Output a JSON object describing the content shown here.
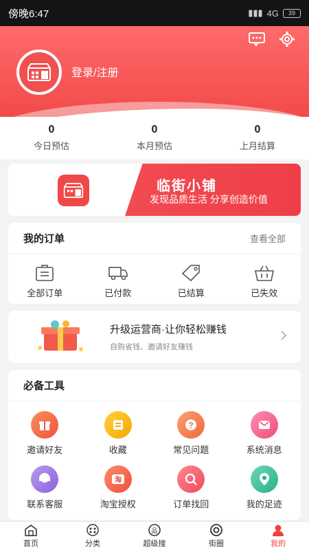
{
  "status": {
    "time": "傍晚6:47",
    "network": "4G",
    "battery": "39"
  },
  "header": {
    "login": "登录/注册"
  },
  "stats": [
    {
      "value": "0",
      "label": "今日预估"
    },
    {
      "value": "0",
      "label": "本月预估"
    },
    {
      "value": "0",
      "label": "上月结算"
    }
  ],
  "banner": {
    "title": "临街小铺",
    "subtitle": "发现品质生活 分享创造价值"
  },
  "orders": {
    "title": "我的订单",
    "more": "查看全部",
    "items": [
      {
        "label": "全部订单",
        "icon": "list-icon"
      },
      {
        "label": "已付款",
        "icon": "truck-icon"
      },
      {
        "label": "已结算",
        "icon": "tag-icon"
      },
      {
        "label": "已失效",
        "icon": "basket-icon"
      }
    ]
  },
  "upgrade": {
    "title": "升级运营商·让你轻松赚钱",
    "subtitle": "自购省钱、邀请好友赚钱"
  },
  "tools": {
    "title": "必备工具",
    "items": [
      {
        "label": "邀请好友",
        "color": "#f26a4b",
        "icon": "gift-icon"
      },
      {
        "label": "收藏",
        "color": "#f5b400",
        "icon": "bookmark-icon"
      },
      {
        "label": "常见问题",
        "color": "#f47a4f",
        "icon": "question-icon"
      },
      {
        "label": "系统消息",
        "color": "#f45a86",
        "icon": "mail-icon"
      },
      {
        "label": "联系客服",
        "color": "#9a73e0",
        "icon": "service-icon"
      },
      {
        "label": "淘宝授权",
        "color": "#f4604c",
        "icon": "taobao-icon"
      },
      {
        "label": "订单找回",
        "color": "#f06272",
        "icon": "search-icon"
      },
      {
        "label": "我的足迹",
        "color": "#3fc19a",
        "icon": "location-icon"
      }
    ]
  },
  "tabs": [
    {
      "label": "首页",
      "icon": "home-icon"
    },
    {
      "label": "分类",
      "icon": "category-icon"
    },
    {
      "label": "超级搜",
      "icon": "search-icon"
    },
    {
      "label": "街圈",
      "icon": "circle-icon"
    },
    {
      "label": "我的",
      "icon": "user-icon",
      "active": true
    }
  ]
}
